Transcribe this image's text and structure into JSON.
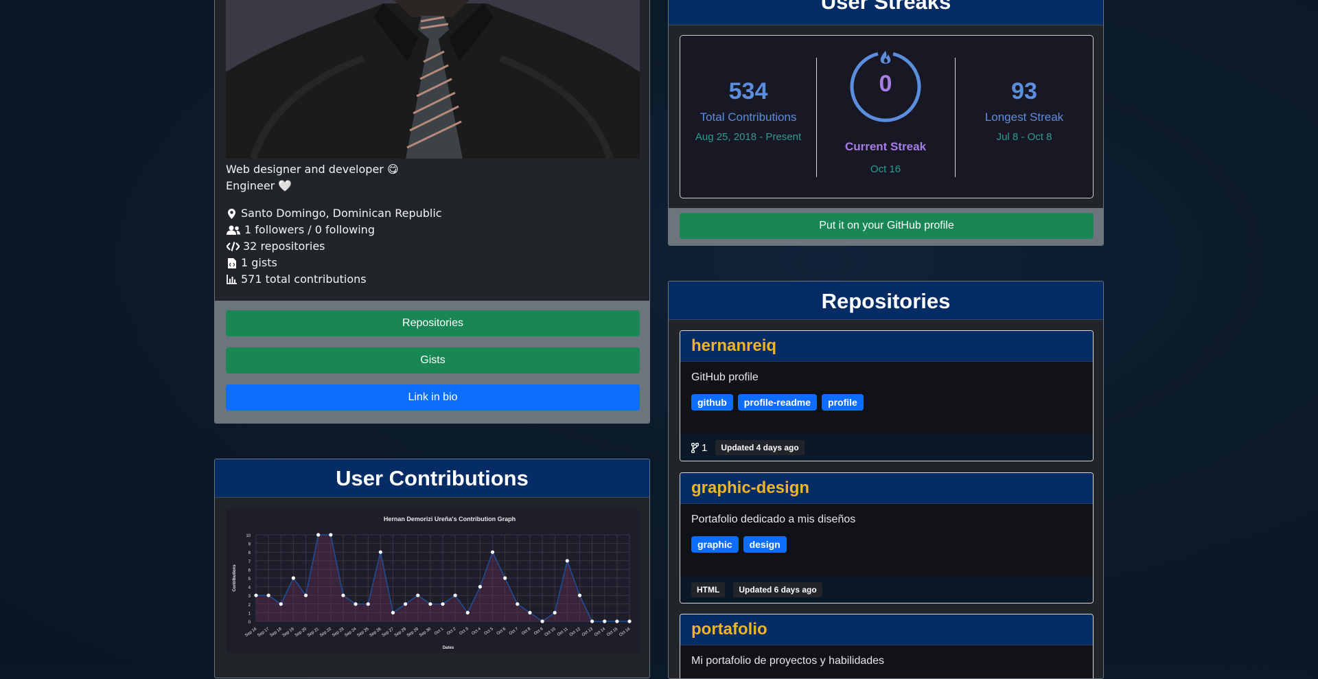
{
  "profile": {
    "bio_line1": "Web designer and developer 😋",
    "bio_line2": "Engineer 🤍",
    "location": "Santo Domingo, Dominican Republic",
    "followers": "1 followers / 0 following",
    "repositories": "32 repositories",
    "gists": "1 gists",
    "total_contributions": "571 total contributions",
    "buttons": {
      "repositories": "Repositories",
      "gists": "Gists",
      "link_in_bio": "Link in bio"
    }
  },
  "contributions": {
    "title": "User Contributions"
  },
  "chart_data": {
    "type": "line",
    "title": "Hernan Demorizi Ureña's Contribution Graph",
    "xlabel": "Dates",
    "ylabel": "Contributions",
    "ylim": [
      0,
      10
    ],
    "yticks": [
      0,
      1,
      2,
      3,
      4,
      5,
      6,
      7,
      8,
      9,
      10
    ],
    "grid": true,
    "categories": [
      "Sep 16",
      "Sep 17",
      "Sep 18",
      "Sep 19",
      "Sep 20",
      "Sep 21",
      "Sep 22",
      "Sep 23",
      "Sep 24",
      "Sep 25",
      "Sep 26",
      "Sep 27",
      "Sep 28",
      "Sep 29",
      "Sep 30",
      "Oct 1",
      "Oct 2",
      "Oct 3",
      "Oct 4",
      "Oct 5",
      "Oct 6",
      "Oct 7",
      "Oct 8",
      "Oct 9",
      "Oct 10",
      "Oct 11",
      "Oct 12",
      "Oct 13",
      "Oct 14",
      "Oct 15",
      "Oct 16"
    ],
    "series": [
      {
        "values": [
          3,
          3,
          2,
          5,
          3,
          10,
          10,
          3,
          2,
          2,
          8,
          1,
          2,
          3,
          2,
          2,
          3,
          1,
          4,
          8,
          5,
          2,
          1,
          0,
          1,
          7,
          3,
          0,
          0,
          0,
          0
        ]
      }
    ]
  },
  "streaks": {
    "title": "User Streaks",
    "total": {
      "value": "534",
      "label": "Total Contributions",
      "range": "Aug 25, 2018 - Present"
    },
    "current": {
      "value": "0",
      "label": "Current Streak",
      "range": "Oct 16"
    },
    "longest": {
      "value": "93",
      "label": "Longest Streak",
      "range": "Jul 8 - Oct 8"
    },
    "button": "Put it on your GitHub profile"
  },
  "repositories": {
    "title": "Repositories",
    "items": [
      {
        "name": "hernanreiq",
        "description": "GitHub profile",
        "tags": [
          "github",
          "profile-readme",
          "profile"
        ],
        "forks": "1",
        "updated": "Updated 4 days ago"
      },
      {
        "name": "graphic-design",
        "description": "Portafolio dedicado a mis diseños",
        "tags": [
          "graphic",
          "design"
        ],
        "language": "HTML",
        "updated": "Updated 6 days ago"
      },
      {
        "name": "portafolio",
        "description": "Mi portafolio de proyectos y habilidades"
      }
    ]
  },
  "colors": {
    "green_button": "#198754",
    "blue_button": "#0d6efd",
    "header_blue": "#052c65",
    "repo_title": "#f0b429",
    "streak_blue": "#5c8ede",
    "streak_purple": "#a77ee6"
  }
}
